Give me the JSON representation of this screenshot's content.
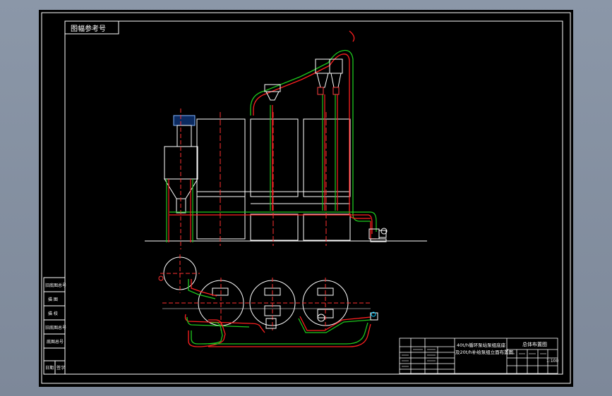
{
  "drawing": {
    "background": "#000000",
    "viewport_bg": "#8b97a8",
    "line_colors": {
      "frame": "#ffffff",
      "pipe_red": "#ff2020",
      "pipe_green": "#1ec81e",
      "center_line": "#ff3030",
      "fitting": "#00c8ff"
    },
    "top_left_label": "图幅参考号",
    "side_table": [
      "旧底图总号",
      "描 图",
      "描 校",
      "旧底图总号",
      "底图总号",
      "日期",
      "签字"
    ],
    "title_block": {
      "title_line1": "40t/h循环泵站泵组底座",
      "title_line2": "及20t/h补给泵组立面布置图",
      "right_title": "总体布置图",
      "scale": "1:100"
    }
  }
}
